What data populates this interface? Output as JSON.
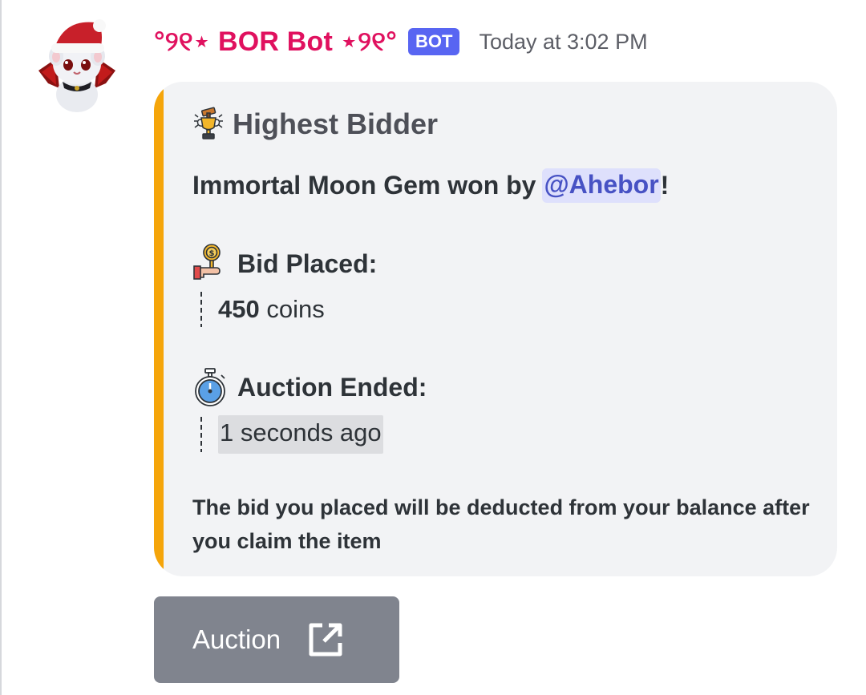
{
  "message": {
    "author": {
      "name": "°୨୧⋆ BOR Bot ⋆୨୧°",
      "tag": "BOT",
      "name_color": "#e0115f",
      "avatar_icon": "vampire-cat-santa-hat-avatar"
    },
    "timestamp": "Today at 3:02 PM"
  },
  "embed": {
    "accent_color": "#f5a50a",
    "title_icon": "trophy-gavel-icon",
    "title": "Highest Bidder",
    "description_prefix": "Immortal Moon Gem won by ",
    "mention": "@Ahebor",
    "description_suffix": "!",
    "fields": [
      {
        "icon": "hand-holding-coin-icon",
        "name": "Bid Placed:",
        "value_bold": "450",
        "value_rest": " coins"
      },
      {
        "icon": "stopwatch-icon",
        "name": "Auction Ended:",
        "value": "1 seconds ago"
      }
    ],
    "footer": "The bid you placed will be deducted from your balance after you claim the item"
  },
  "button": {
    "label": "Auction",
    "icon": "external-link-icon",
    "color": "#80848e"
  }
}
